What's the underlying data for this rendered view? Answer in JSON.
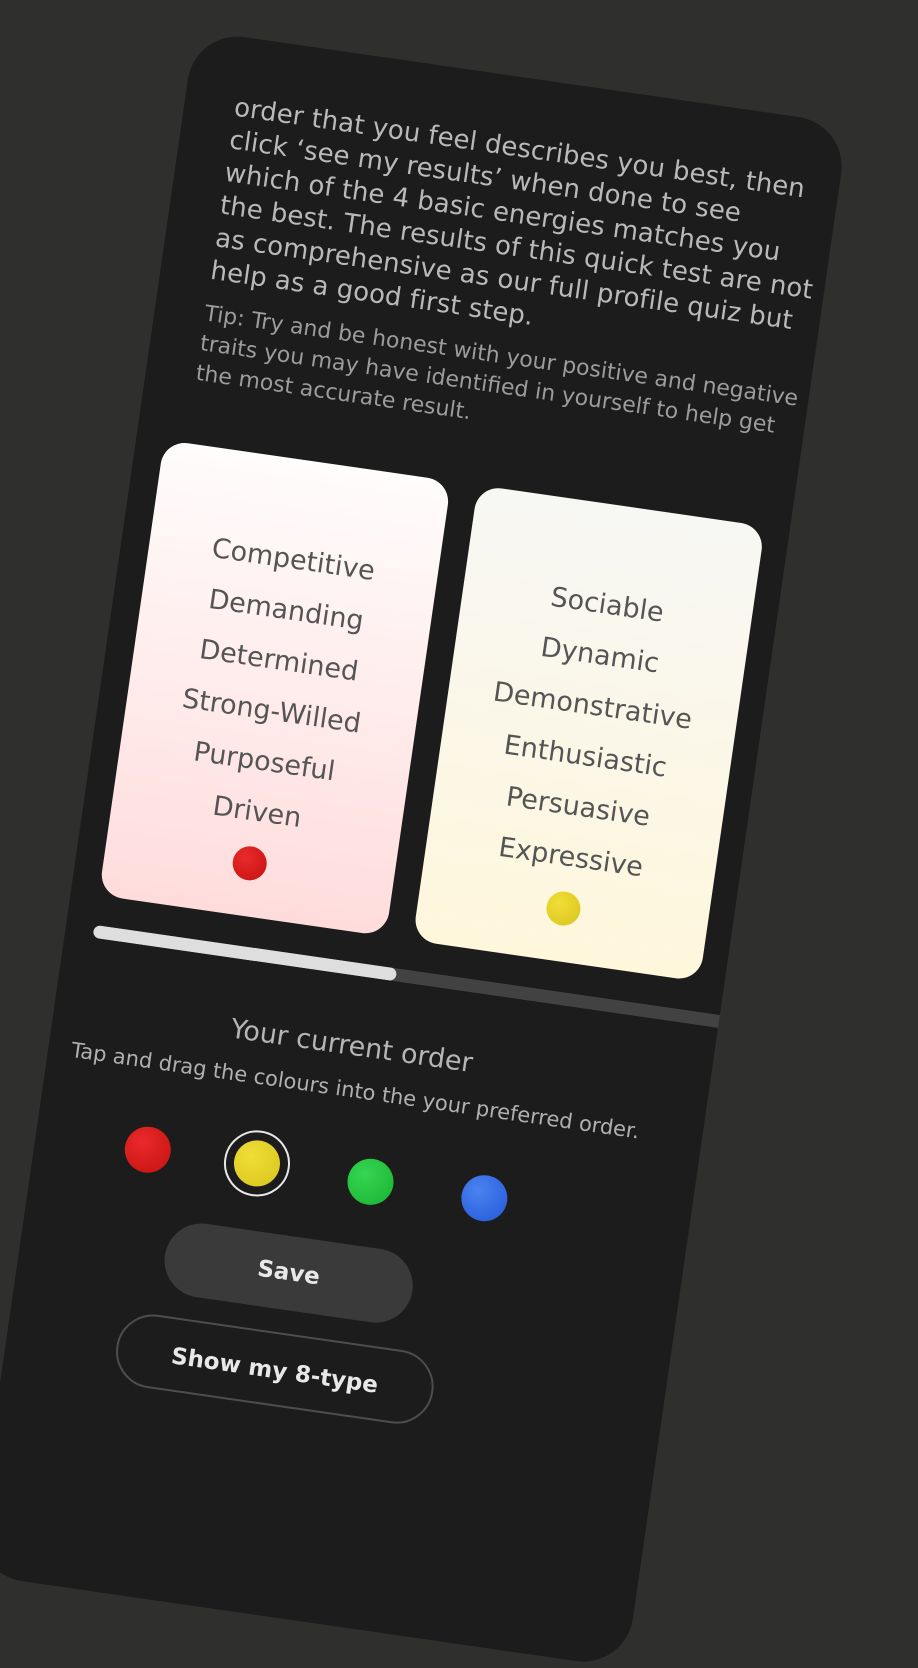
{
  "intro": {
    "text": "order that you feel describes you best, then click ‘see my results’ when done to see which of the 4 basic energies matches you the best. The results of this quick test are not as comprehensive as our full profile quiz but help as a good first step."
  },
  "tip": {
    "text": "Tip: Try and be honest with your positive and negative traits you may have identified in yourself to help get the most accurate result."
  },
  "cards": [
    {
      "color_name": "red",
      "color": "#d01a17",
      "traits": [
        "Competitive",
        "Demanding",
        "Determined",
        "Strong-Willed",
        "Purposeful",
        "Driven"
      ]
    },
    {
      "color_name": "yellow",
      "color": "#e2cf26",
      "traits": [
        "Sociable",
        "Dynamic",
        "Demonstrative",
        "Enthusiastic",
        "Persuasive",
        "Expressive"
      ]
    }
  ],
  "progress": {
    "fraction": 0.47
  },
  "order": {
    "title": "Your current order",
    "hint": "Tap and drag the colours into the your preferred order.",
    "items": [
      {
        "name": "red",
        "color": "#d41816",
        "selected": false
      },
      {
        "name": "yellow",
        "color": "#e0ce22",
        "selected": true
      },
      {
        "name": "green",
        "color": "#1fc13c",
        "selected": false
      },
      {
        "name": "blue",
        "color": "#2f66e0",
        "selected": false
      }
    ]
  },
  "buttons": {
    "save_label": "Save",
    "show_label": "Show my 8-type"
  }
}
